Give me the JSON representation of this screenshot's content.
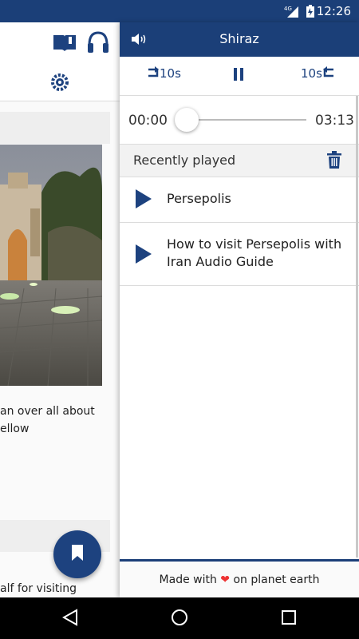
{
  "status_bar": {
    "time": "12:26",
    "network": "4G",
    "icons": [
      "signal-icon",
      "battery-charging-icon"
    ]
  },
  "background_app": {
    "icons": [
      "book-icon",
      "headphones-icon",
      "settings-icon",
      "bookmark-icon"
    ],
    "caption_lines": [
      "an over all about",
      "ellow"
    ],
    "bottom_caption": "alf for visiting"
  },
  "player": {
    "city_title": "Shiraz",
    "rewind_label": "10s",
    "forward_label": "10s",
    "current_time": "00:00",
    "total_time": "03:13",
    "progress": 0
  },
  "recently_played": {
    "header": "Recently played",
    "items": [
      {
        "title": "Persepolis"
      },
      {
        "title": "How to visit Persepolis with Iran Audio Guide"
      }
    ]
  },
  "footer": {
    "prefix": "Made with",
    "suffix": "on planet earth",
    "heart": "❤"
  },
  "colors": {
    "brand": "#1b3f78",
    "accent": "#1d427f",
    "heart": "#e33333"
  }
}
